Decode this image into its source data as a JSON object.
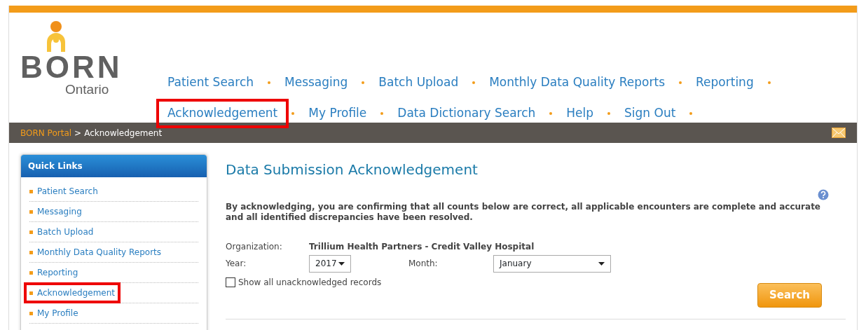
{
  "logo": {
    "title": "BORN",
    "subtitle": "Ontario"
  },
  "nav": [
    {
      "label": "Patient Search",
      "highlighted": false
    },
    {
      "label": "Messaging",
      "highlighted": false
    },
    {
      "label": "Batch Upload",
      "highlighted": false
    },
    {
      "label": "Monthly Data Quality Reports",
      "highlighted": false
    },
    {
      "label": "Reporting",
      "highlighted": false
    },
    {
      "label": "Acknowledgement",
      "highlighted": true
    },
    {
      "label": "My Profile",
      "highlighted": false
    },
    {
      "label": "Data Dictionary Search",
      "highlighted": false
    },
    {
      "label": "Help",
      "highlighted": false
    },
    {
      "label": "Sign Out",
      "highlighted": false
    }
  ],
  "breadcrumb": {
    "link": "BORN Portal",
    "separator": ">",
    "current": "Acknowledgement"
  },
  "quick_links": {
    "title": "Quick Links",
    "items": [
      {
        "label": "Patient Search",
        "highlighted": false
      },
      {
        "label": "Messaging",
        "highlighted": false
      },
      {
        "label": "Batch Upload",
        "highlighted": false
      },
      {
        "label": "Monthly Data Quality Reports",
        "highlighted": false
      },
      {
        "label": "Reporting",
        "highlighted": false
      },
      {
        "label": "Acknowledgement",
        "highlighted": true
      },
      {
        "label": "My Profile",
        "highlighted": false
      }
    ]
  },
  "main": {
    "title": "Data Submission Acknowledgement",
    "notice": "By acknowledging, you are confirming that all counts below are correct, all applicable encounters are complete and accurate and all identified discrepancies have been resolved.",
    "organization_label": "Organization:",
    "organization": "Trillium Health Partners - Credit Valley Hospital",
    "year_label": "Year:",
    "year": "2017",
    "month_label": "Month:",
    "month": "January",
    "show_all": {
      "label": "Show all unacknowledged records",
      "checked": false
    },
    "search_button": "Search"
  }
}
